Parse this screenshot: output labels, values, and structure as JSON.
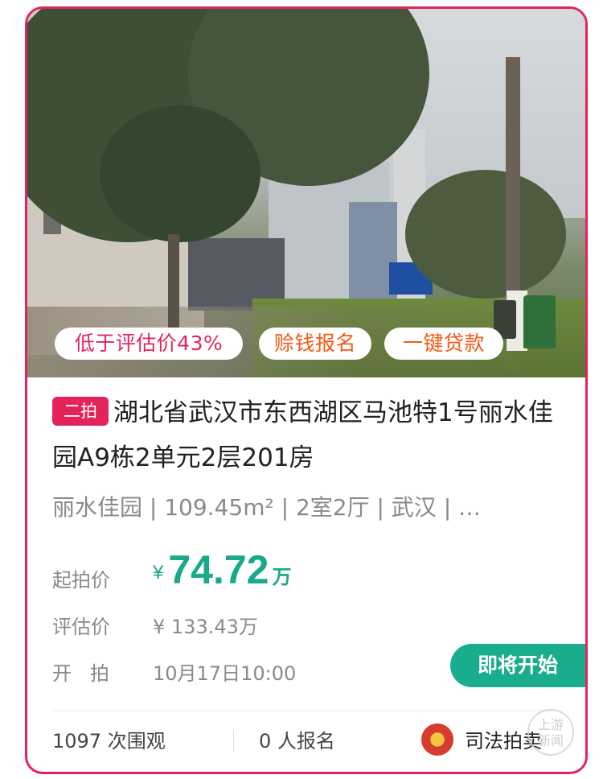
{
  "listing": {
    "tags": [
      "低于评估价43%",
      "赊钱报名",
      "一键贷款"
    ],
    "round_badge": "二拍",
    "title": "湖北省武汉市东西湖区马池特1号丽水佳园A9栋2单元2层201房",
    "meta": "丽水佳园 | 109.45m² | 2室2厅 | 武汉 | …",
    "start_price_label": "起拍价",
    "start_price_currency": "¥",
    "start_price_value": "74.72",
    "start_price_unit": "万",
    "eval_price_label": "评估价",
    "eval_price_value": "¥ 133.43万",
    "start_time_label": "开   拍",
    "start_time_value": "10月17日10:00",
    "status_button": "即将开始",
    "views": "1097 次围观",
    "signups": "0 人报名",
    "platform": "司法拍卖",
    "watermark": "上游\n新闻"
  },
  "colors": {
    "accent": "#e3245b",
    "price": "#1aa98a",
    "status": "#19ad8e",
    "tag_orange": "#f25a16"
  },
  "icons": [
    "court-emblem-icon"
  ]
}
